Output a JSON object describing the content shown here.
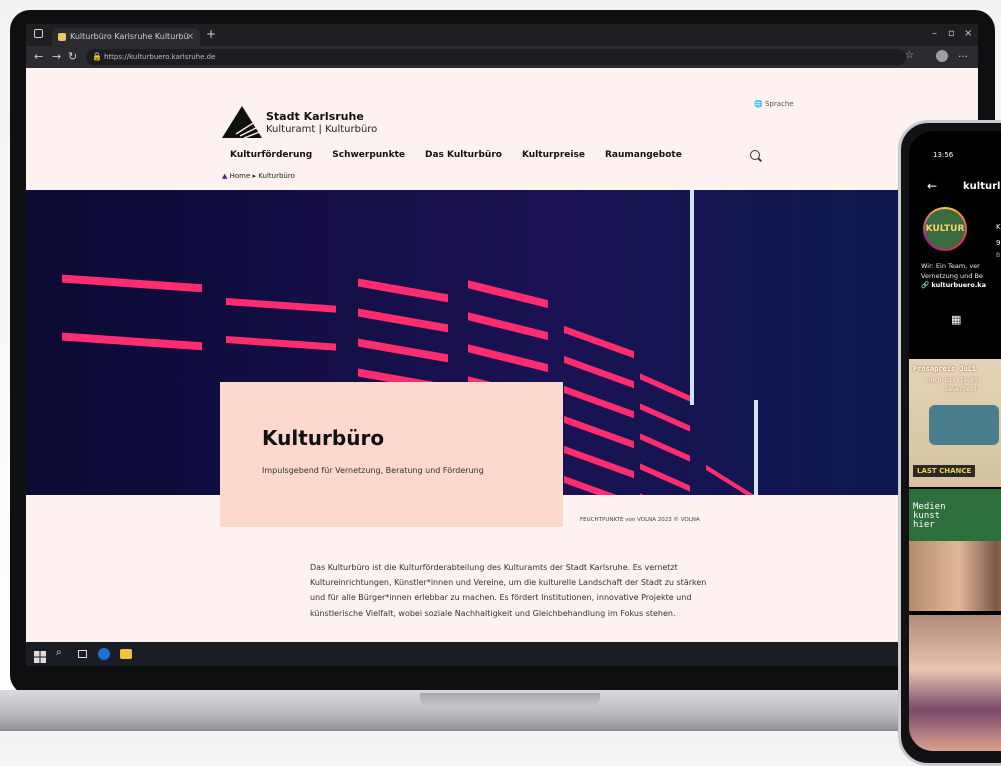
{
  "browser": {
    "tab_title": "Kulturbüro Karlsruhe Kulturbü",
    "tab_close": "×",
    "new_tab": "+",
    "url": "https://kulturbuero.karlsruhe.de",
    "win_min": "–",
    "win_max": "▫",
    "win_close": "×"
  },
  "header": {
    "logo_title": "Stadt Karlsruhe",
    "logo_subtitle": "Kulturamt | Kulturbüro",
    "language_label": "Sprache"
  },
  "nav": {
    "items": [
      {
        "label": "Kulturförderung"
      },
      {
        "label": "Schwerpunkte"
      },
      {
        "label": "Das Kulturbüro"
      },
      {
        "label": "Kulturpreise"
      },
      {
        "label": "Raumangebote"
      }
    ]
  },
  "breadcrumb": {
    "home": "Home",
    "separator": "▸",
    "current": "Kulturbüro"
  },
  "hero": {
    "title": "Kulturbüro",
    "subtitle": "Impulsgebend für Vernetzung, Beratung und Förderung",
    "credit": "FEUCHTPUNKTE von VOLNA 2023 © VOLNA"
  },
  "intro": {
    "text": "Das Kulturbüro ist die Kulturförderabteilung des Kulturamts der Stadt Karlsruhe. Es vernetzt Kultureinrichtungen, Künstler*innen und Vereine, um die kulturelle Landschaft der Stadt zu stärken und für alle Bürger*innen erlebbar zu machen. Es fördert Institutionen, innovative Projekte und künstlerische Vielfalt, wobei soziale Nachhaltigkeit und Gleichbehandlung im Fokus stehen."
  },
  "phone": {
    "time": "13:56",
    "back": "←",
    "username": "kulturl",
    "avatar_text": "KULTUR",
    "stat1": "K",
    "stat2": "9",
    "stat3": "B",
    "bio_line1": "Wir: Ein Team, ver",
    "bio_line2": "Vernetzung und Be",
    "link": "kulturbuero.ka",
    "post1_line1": "Prosapreis JuLi",
    "post1_line2": "noch bis 19.05.",
    "post1_line3": "bewerben!",
    "post1_badge": "LAST CHANCE",
    "post2_text": "Medien kunst hier"
  },
  "colors": {
    "page_bg": "#fdf2ef",
    "hero_card": "#fdd9cd",
    "hero_bg": "#0c0b3d",
    "neon": "#ff2d6f",
    "taskbar": "#1b1d24"
  }
}
